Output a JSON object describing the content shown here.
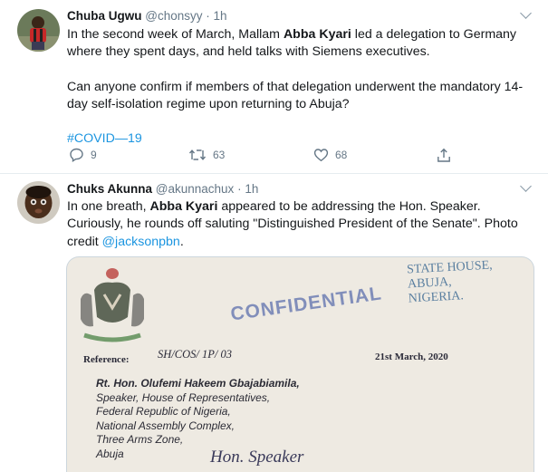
{
  "tweets": [
    {
      "name": "Chuba Ugwu",
      "handle": "@chonsyy",
      "separator": "·",
      "time": "1h",
      "text": {
        "p1_a": "In the second week of March, Mallam ",
        "p1_bold": "Abba Kyari",
        "p1_b": " led a delegation to  Germany where they spent days, and held talks with Siemens executives.",
        "p2": "Can anyone confirm if members of that delegation underwent  the mandatory 14-day self-isolation regime upon returning to Abuja?",
        "hashtag": "#COVID—19"
      },
      "actions": {
        "replies": "9",
        "retweets": "63",
        "likes": "68"
      }
    },
    {
      "name": "Chuks Akunna",
      "handle": "@akunnachux",
      "separator": "·",
      "time": "1h",
      "text": {
        "p1_a": "In one breath, ",
        "p1_bold": "Abba Kyari",
        "p1_b": " appeared to be addressing the Hon. Speaker. Curiously, he rounds off saluting \"Distinguished President of the Senate\". Photo credit ",
        "mention": "@jacksonpbn",
        "p1_end": "."
      },
      "media": {
        "stamp": "CONFIDENTIAL",
        "state_house": [
          "STATE HOUSE,",
          "ABUJA,",
          "NIGERIA."
        ],
        "ref_number": "SH/COS/ 1P/ 03",
        "reference_label": "Reference:",
        "date": "21st March, 2020",
        "addressee": [
          "Rt. Hon. Olufemi Hakeem Gbajabiamila,",
          "Speaker, House of Representatives,",
          "Federal Republic of Nigeria,",
          "National Assembly Complex,",
          "Three Arms Zone,",
          "Abuja"
        ],
        "salutation": "Hon. Speaker"
      }
    }
  ],
  "colors": {
    "link": "#1b95e0",
    "muted": "#657786",
    "border": "#e6ecf0"
  }
}
